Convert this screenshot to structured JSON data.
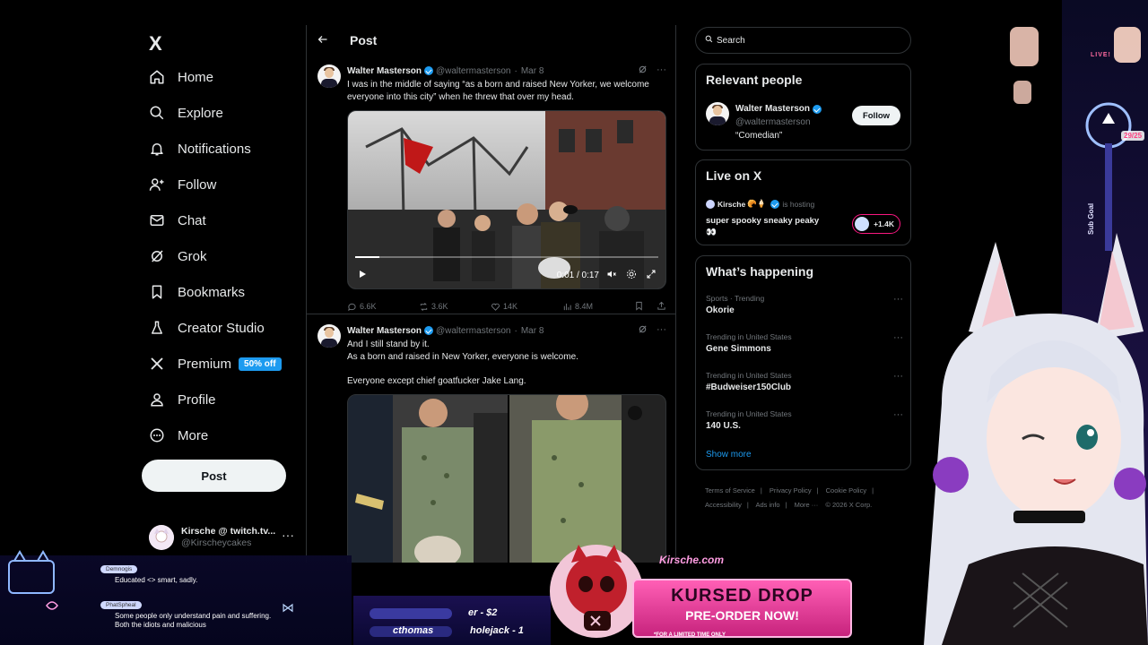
{
  "nav": {
    "logo": "X",
    "items": [
      {
        "label": "Home",
        "icon": "home-icon"
      },
      {
        "label": "Explore",
        "icon": "search-icon"
      },
      {
        "label": "Notifications",
        "icon": "bell-icon"
      },
      {
        "label": "Follow",
        "icon": "person-plus-icon"
      },
      {
        "label": "Chat",
        "icon": "mail-icon"
      },
      {
        "label": "Grok",
        "icon": "grok-icon"
      },
      {
        "label": "Bookmarks",
        "icon": "bookmark-icon"
      },
      {
        "label": "Creator Studio",
        "icon": "flask-icon"
      },
      {
        "label": "Premium",
        "icon": "x-logo-icon",
        "badge": "50% off"
      },
      {
        "label": "Profile",
        "icon": "person-icon"
      },
      {
        "label": "More",
        "icon": "more-circle-icon"
      }
    ],
    "post_button": "Post",
    "account": {
      "name": "Kirsche @ twitch.tv...",
      "handle": "@Kirscheycakes",
      "more": "···"
    }
  },
  "main": {
    "title": "Post",
    "tweets": [
      {
        "name": "Walter Masterson",
        "handle": "@waltermasterson",
        "date": "Mar 8",
        "text": "I was in the middle of saying “as a born and raised New Yorker, we welcome everyone into this city” when he threw that over my head.",
        "video_time": "0:01 / 0:17",
        "stats": {
          "replies": "6.6K",
          "reposts": "3.6K",
          "likes": "14K",
          "views": "8.4M"
        }
      },
      {
        "name": "Walter Masterson",
        "handle": "@waltermasterson",
        "date": "Mar 8",
        "text_lines": [
          "And I still stand by it.",
          "As a born and raised in New Yorker, everyone is welcome.",
          "",
          "Everyone except chief goatfucker Jake Lang."
        ]
      }
    ]
  },
  "right": {
    "search_placeholder": "Search",
    "relevant": {
      "title": "Relevant people",
      "person": {
        "name": "Walter Masterson",
        "handle": "@waltermasterson",
        "bio": "“Comedian”",
        "follow": "Follow"
      }
    },
    "live": {
      "title": "Live on X",
      "host": "Kirsche",
      "host_status": "is hosting",
      "stream_title": "super spooky sneaky peaky",
      "emoji": "👀",
      "count": "+1.4K"
    },
    "happening": {
      "title": "What’s happening",
      "trends": [
        {
          "meta": "Sports · Trending",
          "name": "Okorie"
        },
        {
          "meta": "Trending in United States",
          "name": "Gene Simmons"
        },
        {
          "meta": "Trending in United States",
          "name": "#Budweiser150Club"
        },
        {
          "meta": "Trending in United States",
          "name": "140 U.S."
        }
      ],
      "show_more": "Show more"
    },
    "footer": [
      "Terms of Service",
      "|",
      "Privacy Policy",
      "|",
      "Cookie Policy",
      "|",
      "Accessibility",
      "|",
      "Ads info",
      "|",
      "More ···",
      "© 2026 X Corp."
    ]
  },
  "stream": {
    "chat": [
      {
        "user": "Demnogis",
        "text": "Educated <> smart, sadly."
      },
      {
        "user": "PhatSpheal",
        "text": "Some people only understand pain and suffering. Both the idiots and malicious"
      }
    ],
    "ticker": [
      "er - $2",
      "cthomas",
      "holejack - 1"
    ],
    "promo": {
      "site": "Kirsche.com",
      "title": "KURSED DROP",
      "subtitle": "PRE-ORDER NOW!",
      "note": "*FOR A LIMITED TIME ONLY"
    },
    "sub_goal_label": "Sub Goal",
    "sub_count": "29/25",
    "live_badge": "LIVE!"
  },
  "colors": {
    "accent": "#1d9bf0",
    "background": "#000000",
    "border": "#2f3336",
    "muted": "#71767b",
    "promo": "#ff5fb5"
  }
}
